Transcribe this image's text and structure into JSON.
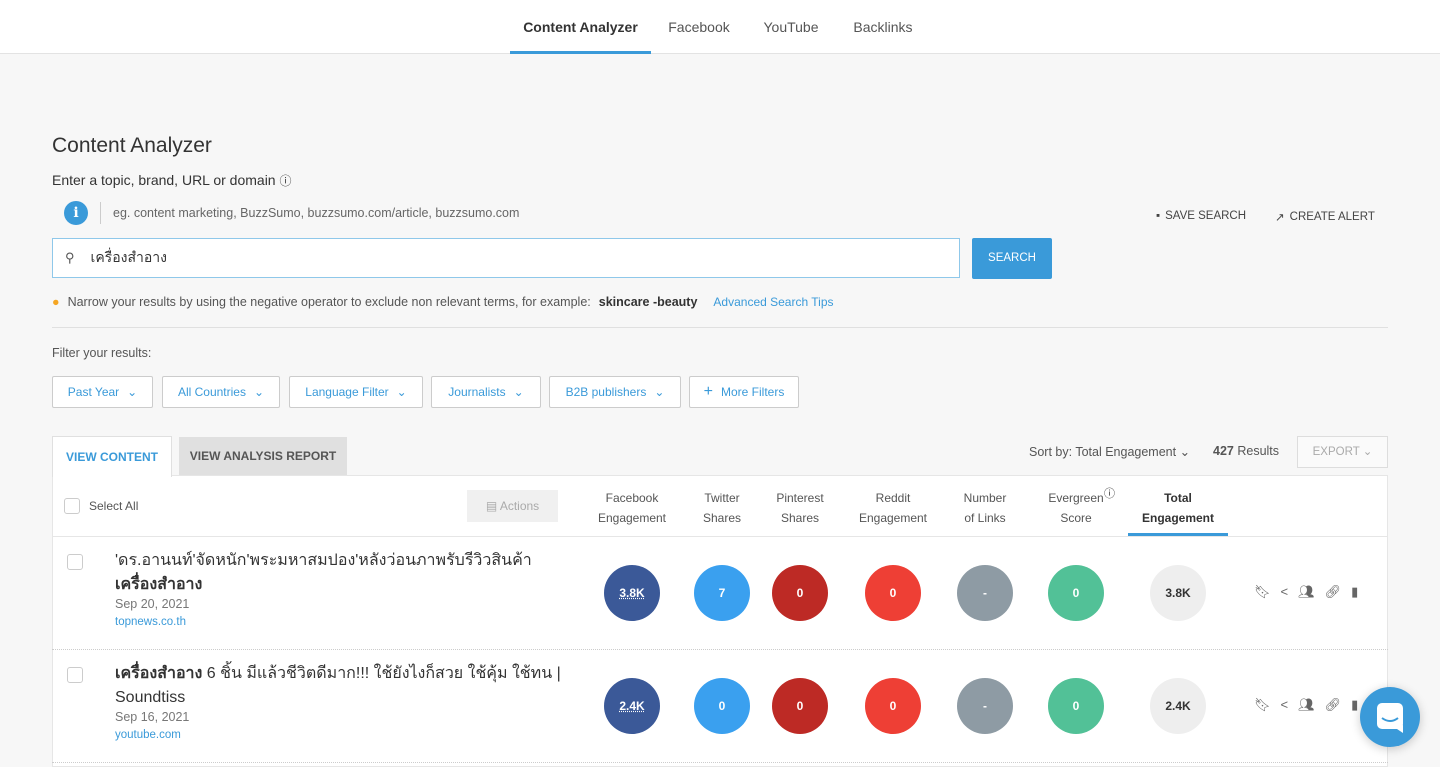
{
  "nav": {
    "tabs": [
      "Content Analyzer",
      "Facebook",
      "YouTube",
      "Backlinks"
    ],
    "active": 0
  },
  "page": {
    "title": "Content Analyzer",
    "subtitle": "Enter a topic, brand, URL or domain",
    "example": "eg. content marketing, BuzzSumo, buzzsumo.com/article, buzzsumo.com",
    "save_search": "SAVE SEARCH",
    "create_alert": "CREATE ALERT"
  },
  "search": {
    "value": "เครื่องสำอาง",
    "button": "SEARCH"
  },
  "tip": {
    "text": "Narrow your results by using the negative operator to exclude non relevant terms, for example:",
    "example": "skincare -beauty",
    "link": "Advanced Search Tips"
  },
  "filters": {
    "label": "Filter your results:",
    "items": [
      "Past Year",
      "All Countries",
      "Language Filter",
      "Journalists",
      "B2B publishers",
      "More Filters"
    ]
  },
  "view_tabs": [
    "VIEW CONTENT",
    "VIEW ANALYSIS REPORT"
  ],
  "sort": {
    "label": "Sort by: Total Engagement",
    "count": "427",
    "count_suffix": "Results",
    "export": "EXPORT"
  },
  "table": {
    "select_all": "Select All",
    "actions": "Actions",
    "columns": [
      [
        "Facebook",
        "Engagement"
      ],
      [
        "Twitter",
        "Shares"
      ],
      [
        "Pinterest",
        "Shares"
      ],
      [
        "Reddit",
        "Engagement"
      ],
      [
        "Number",
        "of Links"
      ],
      [
        "Evergreen",
        "Score"
      ],
      [
        "Total",
        "Engagement"
      ]
    ],
    "colors": [
      "#3b5998",
      "#3aa0ef",
      "#bd2a25",
      "#ee3f35",
      "#8e9ba4",
      "#52c197",
      "#eeeeee"
    ],
    "rows": [
      {
        "title_a": "'ดร.อานนท์'จัดหนัก'พระมหาสมปอง'หลังว่อนภาพรับรีวิวสินค้า",
        "title_b": "เครื่องสำอาง",
        "date": "Sep 20, 2021",
        "domain": "topnews.co.th",
        "values": [
          "3.8K",
          "7",
          "0",
          "0",
          "-",
          "0",
          "3.8K"
        ]
      },
      {
        "title_a": "เครื่องสำอาง",
        "title_b": " 6 ชิ้น มีแล้วชีวิตดีมาก!!! ใช้ยังไงก็สวย ใช้คุ้ม ใช้ทน | Soundtiss",
        "date": "Sep 16, 2021",
        "domain": "youtube.com",
        "values": [
          "2.4K",
          "0",
          "0",
          "0",
          "-",
          "0",
          "2.4K"
        ]
      }
    ]
  }
}
